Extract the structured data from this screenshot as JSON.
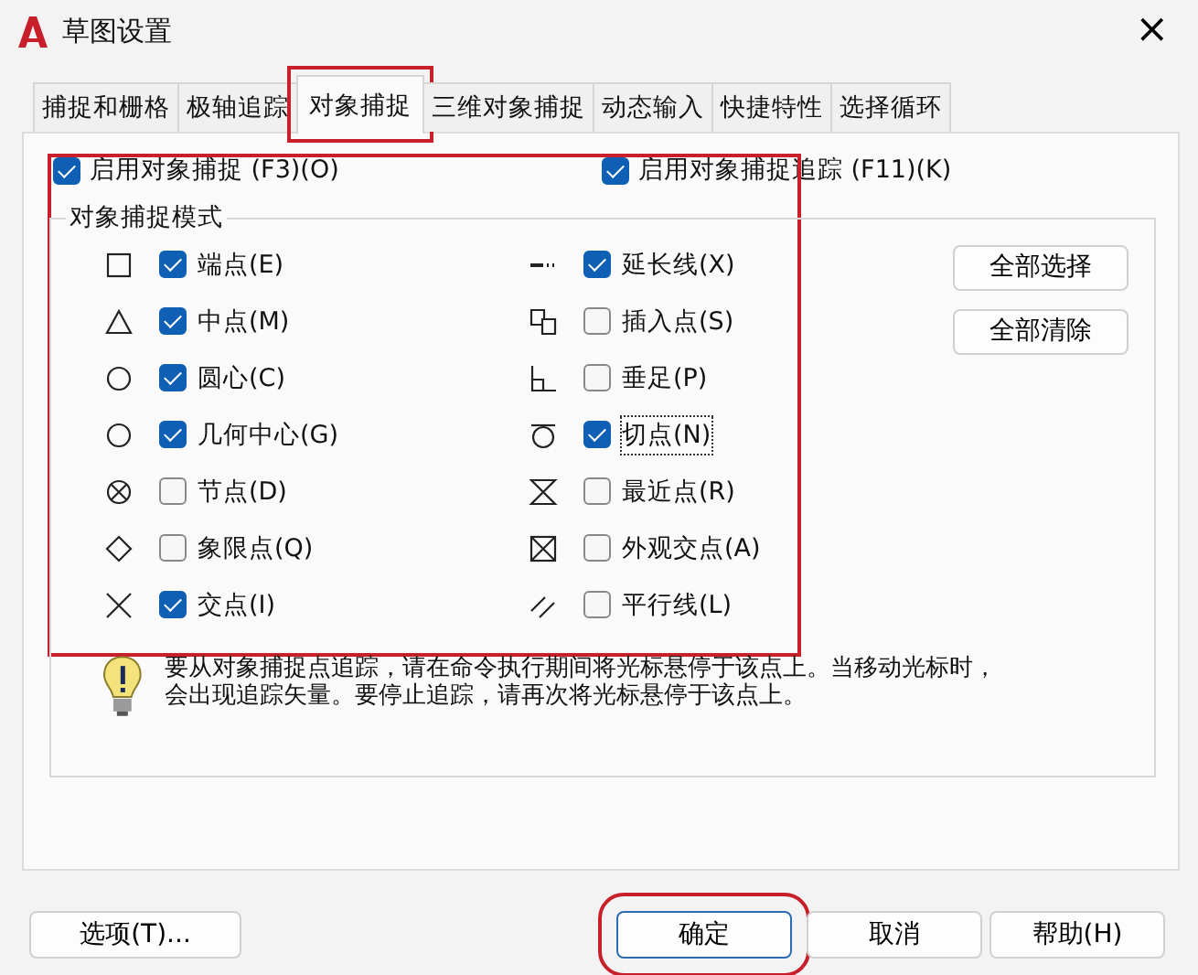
{
  "window": {
    "title": "草图设置",
    "close": "×"
  },
  "tabs": [
    {
      "label": "捕捉和栅格",
      "selected": false,
      "highlighted": false
    },
    {
      "label": "极轴追踪",
      "selected": false,
      "highlighted": false
    },
    {
      "label": "对象捕捉",
      "selected": true,
      "highlighted": true
    },
    {
      "label": "三维对象捕捉",
      "selected": false,
      "highlighted": false
    },
    {
      "label": "动态输入",
      "selected": false,
      "highlighted": false
    },
    {
      "label": "快捷特性",
      "selected": false,
      "highlighted": false
    },
    {
      "label": "选择循环",
      "selected": false,
      "highlighted": false
    }
  ],
  "snap_section": {
    "highlighted": true,
    "enable_snap": {
      "label": "启用对象捕捉 (F3)(O)",
      "checked": true
    },
    "enable_tracking": {
      "label": "启用对象捕捉追踪 (F11)(K)",
      "checked": true
    },
    "modes_group": {
      "title": "对象捕捉模式",
      "left": [
        {
          "kind": "square",
          "label": "端点(E)",
          "checked": true,
          "focused": false
        },
        {
          "kind": "triangle",
          "label": "中点(M)",
          "checked": true,
          "focused": false
        },
        {
          "kind": "circle",
          "label": "圆心(C)",
          "checked": true,
          "focused": false
        },
        {
          "kind": "circle",
          "label": "几何中心(G)",
          "checked": true,
          "focused": false
        },
        {
          "kind": "circlex",
          "label": "节点(D)",
          "checked": false,
          "focused": false
        },
        {
          "kind": "diamond",
          "label": "象限点(Q)",
          "checked": false,
          "focused": false
        },
        {
          "kind": "cross",
          "label": "交点(I)",
          "checked": true,
          "focused": false
        }
      ],
      "right": [
        {
          "kind": "extension",
          "label": "延长线(X)",
          "checked": true,
          "focused": false
        },
        {
          "kind": "insert",
          "label": "插入点(S)",
          "checked": false,
          "focused": false
        },
        {
          "kind": "perpendicular",
          "label": "垂足(P)",
          "checked": false,
          "focused": false
        },
        {
          "kind": "tangent",
          "label": "切点(N)",
          "checked": true,
          "focused": true
        },
        {
          "kind": "hourglass",
          "label": "最近点(R)",
          "checked": false,
          "focused": false
        },
        {
          "kind": "boxx",
          "label": "外观交点(A)",
          "checked": false,
          "focused": false
        },
        {
          "kind": "parallel",
          "label": "平行线(L)",
          "checked": false,
          "focused": false
        }
      ]
    }
  },
  "side_buttons": [
    "全部选择",
    "全部清除"
  ],
  "hint": "要从对象捕捉点追踪，请在命令执行期间将光标悬停于该点上。当移动光标时，会出现追踪矢量。要停止追踪，请再次将光标悬停于该点上。",
  "footer": {
    "options_button": "选项(T)...",
    "buttons": [
      {
        "label": "确定",
        "default": true,
        "highlighted": true
      },
      {
        "label": "取消",
        "default": false,
        "highlighted": false
      },
      {
        "label": "帮助(H)",
        "default": false,
        "highlighted": false
      }
    ]
  }
}
